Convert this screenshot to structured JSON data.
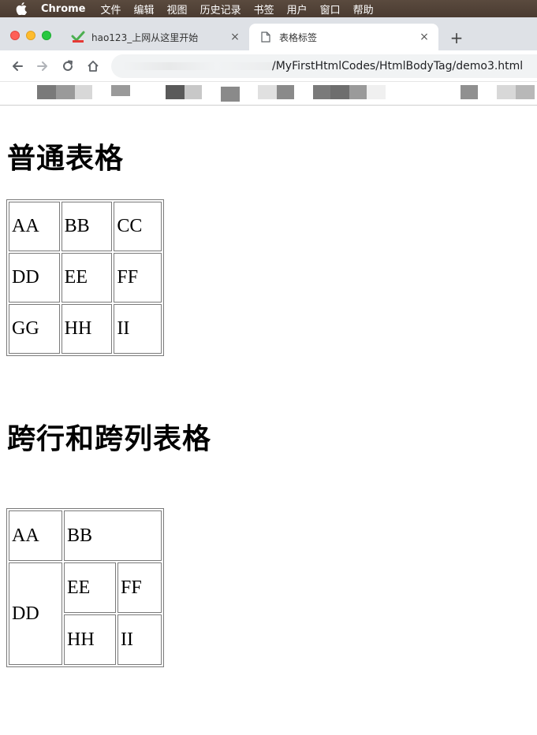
{
  "menubar": {
    "app_name": "Chrome",
    "items": [
      "文件",
      "编辑",
      "视图",
      "历史记录",
      "书签",
      "用户",
      "窗口",
      "帮助"
    ]
  },
  "tabs": [
    {
      "title": "hao123_上网从这里开始",
      "favicon": "hao123-icon",
      "active": false
    },
    {
      "title": "表格标签",
      "favicon": "page-icon",
      "active": true
    }
  ],
  "tab_close_glyph": "×",
  "new_tab_glyph": "+",
  "omnibox": {
    "url": "/MyFirstHtmlCodes/HtmlBodyTag/demo3.html"
  },
  "headings": {
    "normal_table": "普通表格",
    "span_table": "跨行和跨列表格"
  },
  "normal_table": {
    "rows": [
      [
        "AA",
        "BB",
        "CC"
      ],
      [
        "DD",
        "EE",
        "FF"
      ],
      [
        "GG",
        "HH",
        "II"
      ]
    ]
  },
  "span_table": {
    "r1c1": "AA",
    "r1c2_colspan2": "BB",
    "r2c1_rowspan2": "DD",
    "r2c2": "EE",
    "r2c3": "FF",
    "r3c2": "HH",
    "r3c3": "II"
  },
  "colors": {
    "menubar": "#4a3b31",
    "tabstrip": "#dee1e6",
    "omnibox": "#f1f3f4",
    "table_border": "#7a7a7a"
  }
}
